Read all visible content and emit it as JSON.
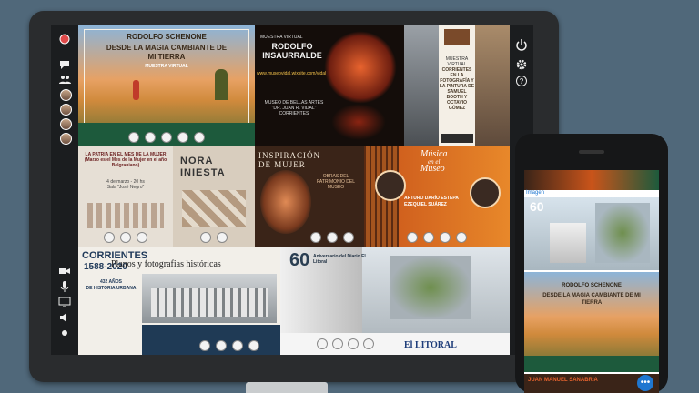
{
  "tiles": {
    "schenone": {
      "artist": "RODOLFO SCHENONE",
      "title": "DESDE LA MAGIA CAMBIANTE DE MI TIERRA",
      "subtitle": "MUESTRA VIRTUAL"
    },
    "insaurralde": {
      "kicker": "MUESTRA VIRTUAL",
      "artist_line1": "RODOLFO",
      "artist_line2": "INSAURRALDE",
      "url": "www.museovidal.wixsite.com/vidal",
      "museum": "MUSEO DE BELLAS ARTES\n\"DR. JUAN R. VIDAL\"\nCORRIENTES"
    },
    "corrientes_foto": {
      "kicker": "MUESTRA VIRTUAL",
      "title": "CORRIENTES EN LA FOTOGRAFÍA Y LA PINTURA DE SAMUEL BOOTH Y OCTAVIO GÓMEZ"
    },
    "patria": {
      "title": "LA PATRIA EN EL MES DE LA MUJER (Marzo es el Mes de la Mujer en el año Belgraniano)",
      "date": "4 de marzo - 20 hs",
      "venue": "Sala \"José Negro\""
    },
    "nora": {
      "artist_line1": "NORA",
      "artist_line2": "INIESTA"
    },
    "inspiracion": {
      "title_line1": "INSPIRACIÓN",
      "title_line2": "DE MUJER",
      "side": "OBRAS DEL PATRIMONIO DEL MUSEO"
    },
    "musica": {
      "title_line1": "Música",
      "title_line2": "en el",
      "title_line3": "Museo",
      "performers": "ARTURO DARÍO ESTEPA\nEZEQUIEL SUÁREZ"
    },
    "corrientes_hist": {
      "big": "CORRIENTES",
      "years": "1588-2020",
      "overlay": "Planos y fotografias históricas",
      "anos": "432 AÑOS\nDE HISTORIA URBANA"
    },
    "aniversario": {
      "number": "60",
      "text": "Aniversario del Diario El Litoral",
      "newspaper": "El LITORAL"
    }
  },
  "phone": {
    "label": "Imagen",
    "number": "60",
    "artist": "RODOLFO SCHENONE",
    "title": "DESDE LA MAGIA CAMBIANTE DE MI TIERRA",
    "bottom": "JUAN MANUEL SANABRIA"
  },
  "colors": {
    "page_bg": "#50687a",
    "accent_blue": "#1f77d0"
  }
}
